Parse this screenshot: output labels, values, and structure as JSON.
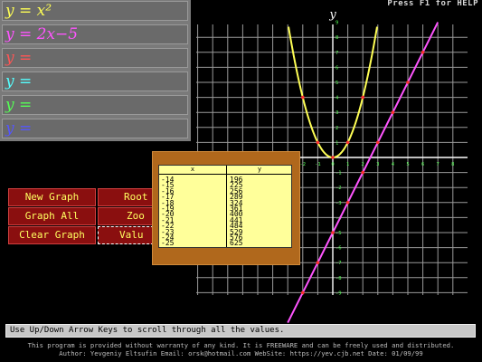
{
  "help_text": "Press F1 for HELP",
  "equations": [
    {
      "text": "y = x²",
      "color": "#ffff55"
    },
    {
      "text": "y = 2x−5",
      "color": "#ff55ff"
    },
    {
      "text": "y =",
      "color": "#ff5555"
    },
    {
      "text": "y =",
      "color": "#55ffff"
    },
    {
      "text": "y =",
      "color": "#55ff55"
    },
    {
      "text": "y =",
      "color": "#5555ff"
    }
  ],
  "buttons": {
    "new_graph": "New Graph",
    "roots": "Root",
    "graph_all": "Graph All",
    "zoom": "Zoo",
    "clear_graph": "Clear Graph",
    "values": "Valu"
  },
  "table": {
    "headers": {
      "x": "x",
      "y": "y"
    },
    "rows": [
      {
        "x": "-14",
        "y": "196"
      },
      {
        "x": "-15",
        "y": "225"
      },
      {
        "x": "-16",
        "y": "256"
      },
      {
        "x": "-17",
        "y": "289"
      },
      {
        "x": "-18",
        "y": "324"
      },
      {
        "x": "-19",
        "y": "361"
      },
      {
        "x": "-20",
        "y": "400"
      },
      {
        "x": "-21",
        "y": "441"
      },
      {
        "x": "-22",
        "y": "484"
      },
      {
        "x": "-23",
        "y": "529"
      },
      {
        "x": "-24",
        "y": "576"
      },
      {
        "x": "-25",
        "y": "625"
      }
    ]
  },
  "graph": {
    "y_axis_label": "y",
    "x_ticks": [
      "-2",
      "-1",
      "0",
      "1",
      "2",
      "3",
      "4",
      "5",
      "6",
      "7",
      "8"
    ],
    "y_ticks": [
      "9",
      "8",
      "7",
      "6",
      "5",
      "4",
      "3",
      "2",
      "1",
      "-1",
      "-2",
      "-3",
      "-4",
      "-5",
      "-6",
      "-7",
      "-8",
      "-9"
    ],
    "x_range": [
      -15,
      8
    ],
    "y_range": [
      -9,
      10
    ],
    "colors": {
      "grid": "#9a9a9a",
      "parabola": "#ffff55",
      "line": "#ff55ff",
      "points": "#ff3030",
      "ticks": "#55ff55"
    }
  },
  "status": "Use Up/Down Arrow Keys to scroll through all the values.",
  "footer_line1": "This program is provided without warranty of any kind. It is FREEWARE and can be freely used and distributed.",
  "footer_line2": "Author: Yevgeniy Eltsufin  Email: orsk@hotmail.com  WebSite: https://yev.cjb.net  Date: 01/09/99"
}
